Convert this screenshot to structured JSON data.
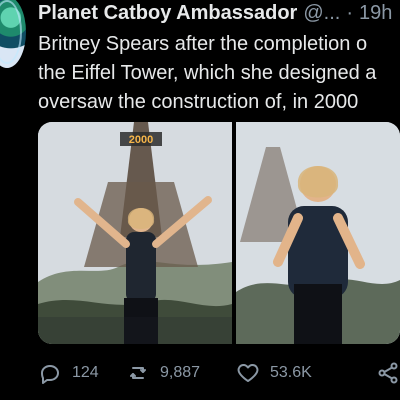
{
  "tweet": {
    "author": {
      "display_name": "Planet Catboy Ambassador",
      "handle": "@...",
      "time": "19h"
    },
    "text_lines": [
      "Britney Spears after the completion o",
      "the Eiffel Tower, which she designed a",
      "oversaw the construction of, in 2000"
    ],
    "media": {
      "left_sign": "2000"
    },
    "actions": {
      "reply_count": "124",
      "retweet_count": "9,887",
      "like_count": "53.6K"
    }
  },
  "colors": {
    "background": "#000000",
    "text_primary": "#e7e9ea",
    "text_secondary": "#8b98a5"
  },
  "icons": {
    "reply": "reply-icon",
    "retweet": "retweet-icon",
    "like": "heart-icon",
    "share": "share-icon",
    "avatar": "avatar"
  }
}
